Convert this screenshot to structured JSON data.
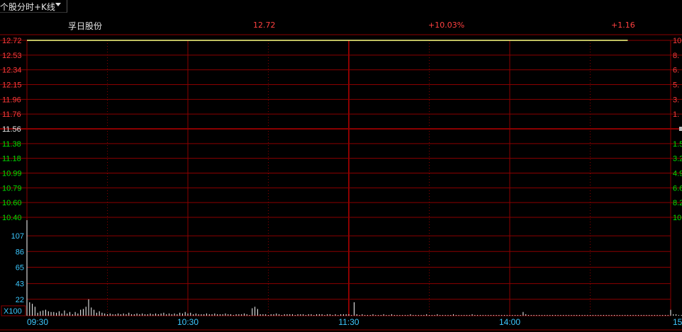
{
  "tab": {
    "label": "个股分时+K线"
  },
  "header": {
    "stock_name": "孚日股份",
    "price": "12.72",
    "change_pct": "+10.03%",
    "change": "+1.16"
  },
  "colors": {
    "up": "#ff3c3c",
    "down": "#00e000",
    "flat": "#e6e6e6",
    "volume_axis": "#3cc8ff",
    "grid": "#8b0000",
    "price_line": "#ffff80"
  },
  "chart_data": {
    "type": "line",
    "price_axis": {
      "ticks": [
        "12.72",
        "12.53",
        "12.34",
        "12.15",
        "11.96",
        "11.76",
        "11.56",
        "11.38",
        "11.18",
        "10.99",
        "10.79",
        "10.60",
        "10.40"
      ],
      "prev_close_index": 6
    },
    "pct_axis": {
      "ticks": [
        "10",
        "8.",
        "6.",
        "5.",
        "3.",
        "1.",
        "",
        "1.5",
        "3.2",
        "4.9",
        "6.6",
        "8.2",
        "10"
      ]
    },
    "volume_axis": {
      "ticks": [
        "107",
        "86",
        "65",
        "43",
        "22"
      ],
      "unit": "X100",
      "max": 128
    },
    "time_labels": [
      "09:30",
      "10:30",
      "11:30",
      "14:00",
      "15"
    ],
    "price_series": {
      "value": 12.72,
      "start_index": 0,
      "end_index": 224,
      "total": 241
    },
    "volume_values": [
      128,
      18,
      16,
      12,
      4,
      6,
      7,
      8,
      6,
      5,
      5,
      4,
      6,
      3,
      7,
      3,
      5,
      2,
      5,
      3,
      8,
      9,
      12,
      22,
      11,
      8,
      4,
      6,
      4,
      3,
      2,
      3,
      2,
      2,
      3,
      2,
      3,
      2,
      4,
      2,
      2,
      3,
      2,
      3,
      2,
      2,
      3,
      2,
      3,
      2,
      3,
      4,
      2,
      3,
      2,
      3,
      2,
      4,
      3,
      5,
      3,
      4,
      2,
      3,
      2,
      2,
      2,
      3,
      2,
      2,
      3,
      2,
      2,
      2,
      3,
      2,
      2,
      1,
      2,
      2,
      2,
      3,
      2,
      1,
      10,
      12,
      9,
      2,
      2,
      2,
      1,
      2,
      2,
      3,
      2,
      1,
      2,
      2,
      2,
      2,
      1,
      2,
      2,
      2,
      1,
      2,
      2,
      1,
      2,
      2,
      2,
      1,
      2,
      2,
      1,
      2,
      1,
      2,
      2,
      2,
      2,
      1,
      18,
      2,
      1,
      2,
      1,
      1,
      1,
      2,
      1,
      1,
      1,
      2,
      1,
      1,
      2,
      1,
      1,
      1,
      1,
      1,
      1,
      2,
      1,
      1,
      1,
      1,
      1,
      2,
      1,
      1,
      1,
      2,
      1,
      1,
      1,
      1,
      1,
      2,
      1,
      1,
      1,
      1,
      1,
      1,
      2,
      1,
      1,
      1,
      1,
      1,
      1,
      1,
      1,
      1,
      1,
      1,
      1,
      1,
      1,
      1,
      1,
      1,
      1,
      5,
      2,
      1,
      1,
      1,
      1,
      1,
      1,
      1,
      1,
      1,
      1,
      1,
      1,
      1,
      1,
      1,
      1,
      1,
      1,
      1,
      1,
      1,
      1,
      1,
      1,
      1,
      1,
      1,
      1,
      1,
      1,
      1,
      1,
      1,
      1,
      1,
      1,
      1,
      1,
      1,
      1,
      1,
      1,
      1,
      1,
      1,
      1,
      1,
      1,
      1,
      1,
      1,
      1,
      1,
      8,
      2,
      2,
      1,
      1,
      1,
      1,
      1,
      1,
      1,
      1,
      1,
      1,
      1,
      1,
      1,
      1,
      1,
      1,
      1
    ]
  }
}
